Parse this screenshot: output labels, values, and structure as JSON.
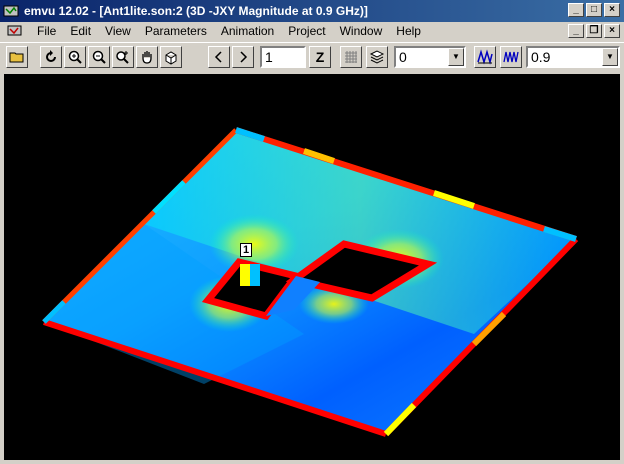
{
  "window": {
    "title": "emvu 12.02 - [Ant1lite.son:2 (3D -JXY Magnitude at 0.9 GHz)]",
    "minimize_label": "_",
    "maximize_label": "□",
    "close_label": "×"
  },
  "menu": {
    "items": [
      "File",
      "Edit",
      "View",
      "Parameters",
      "Animation",
      "Project",
      "Window",
      "Help"
    ],
    "mdi_minimize_label": "_",
    "mdi_restore_label": "❐",
    "mdi_close_label": "×"
  },
  "toolbar": {
    "icons": [
      "open-folder-icon",
      "rotate-icon",
      "zoom-in-icon",
      "zoom-out-icon",
      "zoom-box-icon",
      "pan-hand-icon",
      "3d-box-icon"
    ],
    "level_value": "1",
    "z_label": "Z",
    "layer_value": "0",
    "frequency_value": "0.9"
  },
  "view": {
    "port_label": "1",
    "colormap": [
      "#0000ff",
      "#00c0ff",
      "#00ffc0",
      "#c0ff40",
      "#ffff00",
      "#ff8000",
      "#ff0000"
    ]
  }
}
